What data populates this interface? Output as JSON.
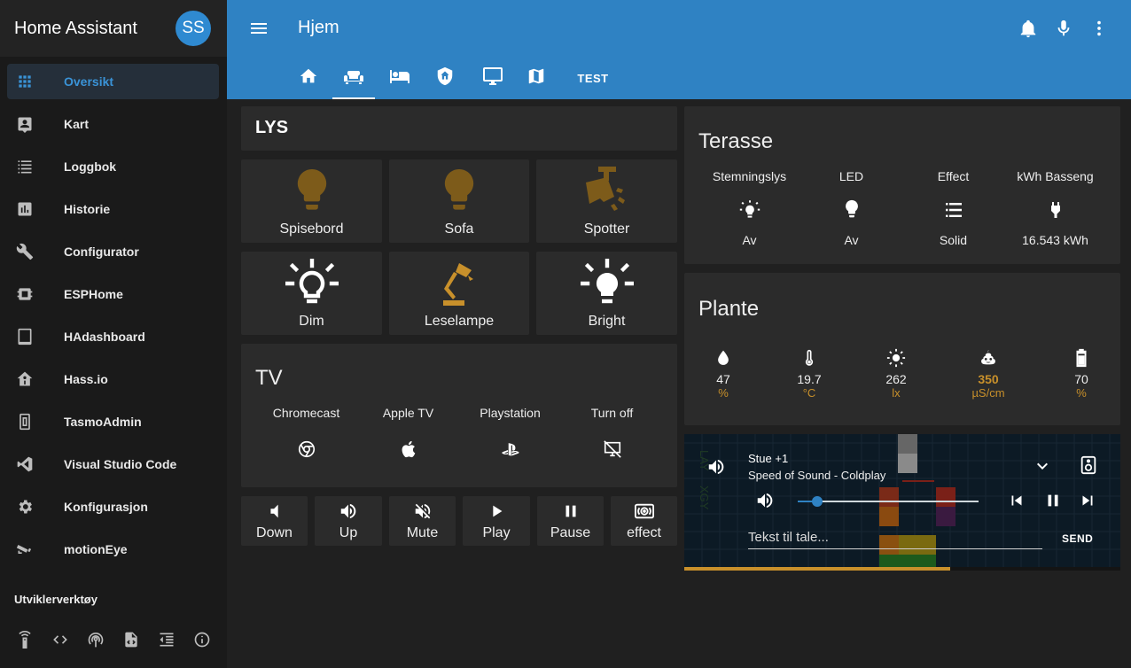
{
  "app": {
    "title": "Home Assistant",
    "avatar_initials": "SS",
    "accent": "#2f82c3",
    "sidebar_bg": "#1a1a1a"
  },
  "sidebar": {
    "items": [
      {
        "label": "Oversikt",
        "icon": "apps-icon",
        "active": true
      },
      {
        "label": "Kart",
        "icon": "account-box-icon"
      },
      {
        "label": "Loggbok",
        "icon": "format-list-bulleted-icon"
      },
      {
        "label": "Historie",
        "icon": "chart-box-icon"
      },
      {
        "label": "Configurator",
        "icon": "wrench-icon"
      },
      {
        "label": "ESPHome",
        "icon": "chip-icon"
      },
      {
        "label": "HAdashboard",
        "icon": "tablet-icon"
      },
      {
        "label": "Hass.io",
        "icon": "home-assistant-icon"
      },
      {
        "label": "TasmoAdmin",
        "icon": "switch-icon"
      },
      {
        "label": "Visual Studio Code",
        "icon": "vscode-icon"
      },
      {
        "label": "Konfigurasjon",
        "icon": "settings-icon"
      },
      {
        "label": "motionEye",
        "icon": "cctv-icon"
      }
    ],
    "dev_title": "Utviklerverktøy",
    "dev_tools": [
      "remote-icon",
      "code-tags-icon",
      "access-point-icon",
      "file-xml-icon",
      "format-indent-icon",
      "information-outline-icon"
    ]
  },
  "header": {
    "title": "Hjem",
    "tabs": [
      {
        "icon": "home-icon"
      },
      {
        "icon": "sofa-icon",
        "active": true
      },
      {
        "icon": "bed-icon"
      },
      {
        "icon": "shield-home-icon"
      },
      {
        "icon": "monitor-icon"
      },
      {
        "icon": "map-icon"
      },
      {
        "label": "TEST"
      }
    ],
    "actions": [
      "bell-icon",
      "microphone-icon",
      "dots-vertical-icon"
    ]
  },
  "lys": {
    "title": "LYS",
    "buttons": [
      {
        "label": "Spisebord",
        "icon": "lightbulb-icon"
      },
      {
        "label": "Sofa",
        "icon": "lightbulb-icon"
      },
      {
        "label": "Spotter",
        "icon": "cctv-spot-icon"
      },
      {
        "label": "Dim",
        "icon": "lightbulb-on-outline-icon"
      },
      {
        "label": "Leselampe",
        "icon": "desk-lamp-icon"
      },
      {
        "label": "Bright",
        "icon": "lightbulb-on-icon"
      }
    ],
    "icon_color": "#7d5b1a"
  },
  "tv": {
    "title": "TV",
    "entities": [
      {
        "name": "Chromecast",
        "icon": "google-chrome-icon"
      },
      {
        "name": "Apple TV",
        "icon": "apple-icon"
      },
      {
        "name": "Playstation",
        "icon": "playstation-icon"
      },
      {
        "name": "Turn off",
        "icon": "monitor-off-icon"
      }
    ]
  },
  "media_buttons": [
    {
      "label": "Down",
      "icon": "volume-low-icon"
    },
    {
      "label": "Up",
      "icon": "volume-high-icon"
    },
    {
      "label": "Mute",
      "icon": "volume-off-icon"
    },
    {
      "label": "Play",
      "icon": "play-icon"
    },
    {
      "label": "Pause",
      "icon": "pause-icon"
    },
    {
      "label": "effect",
      "icon": "surround-sound-icon"
    }
  ],
  "terasse": {
    "title": "Terasse",
    "entities": [
      {
        "name": "Stemningslys",
        "state": "Av",
        "icon": "lightbulb-on-outline-icon"
      },
      {
        "name": "LED",
        "state": "Av",
        "icon": "lightbulb-icon"
      },
      {
        "name": "Effect",
        "state": "Solid",
        "icon": "format-list-bulleted-icon"
      },
      {
        "name": "kWh Basseng",
        "state": "16.543 kWh",
        "icon": "power-plug-icon"
      }
    ]
  },
  "plante": {
    "title": "Plante",
    "sensors": [
      {
        "value": "47",
        "unit": "%",
        "icon": "water-icon"
      },
      {
        "value": "19.7",
        "unit": "°C",
        "icon": "thermometer-icon"
      },
      {
        "value": "262",
        "unit": "lx",
        "icon": "white-balance-sunny-icon"
      },
      {
        "value": "350",
        "unit": "µS/cm",
        "icon": "emoticon-poop-icon",
        "warn": true
      },
      {
        "value": "70",
        "unit": "%",
        "icon": "battery-icon"
      }
    ]
  },
  "media_player": {
    "name": "Stue +1",
    "track": "Speed of Sound - Coldplay",
    "volume": 0.11,
    "progress": 0.61,
    "tts_placeholder": "Tekst til tale...",
    "send_label": "SEND",
    "art_text_1": "LAY",
    "art_text_2": "XGY"
  }
}
